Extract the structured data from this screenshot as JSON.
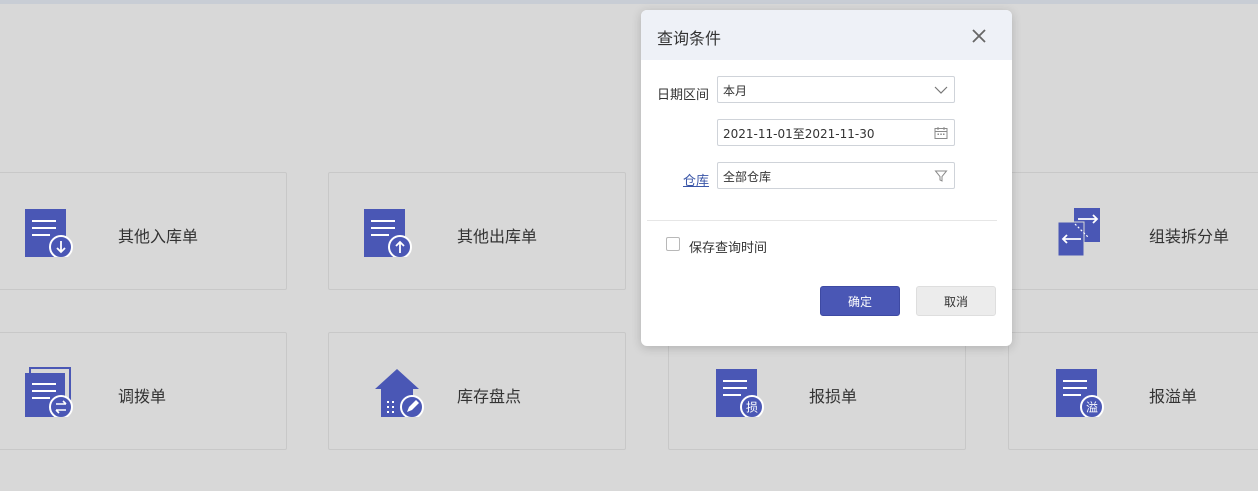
{
  "tiles": [
    {
      "label": "其他入库单",
      "icon": "doc-arrow-down-icon"
    },
    {
      "label": "其他出库单",
      "icon": "doc-arrow-up-icon"
    },
    {
      "label": "组装拆分单",
      "icon": "swap-docs-icon"
    },
    {
      "label": "调拨单",
      "icon": "doc-transfer-icon"
    },
    {
      "label": "库存盘点",
      "icon": "house-edit-icon"
    },
    {
      "label": "报损单",
      "icon": "doc-loss-icon",
      "badge": "损"
    },
    {
      "label": "报溢单",
      "icon": "doc-overflow-icon",
      "badge": "溢"
    }
  ],
  "dialog": {
    "title": "查询条件",
    "date_range_label": "日期区间",
    "period_value": "本月",
    "date_range_value": "2021-11-01至2021-11-30",
    "warehouse_label": "仓库",
    "warehouse_value": "全部仓库",
    "save_time_label": "保存查询时间",
    "save_time_checked": false,
    "confirm_label": "确定",
    "cancel_label": "取消"
  },
  "colors": {
    "accent": "#4a57b5",
    "background": "#d8d8d8",
    "dialog_header": "#eef1f7"
  }
}
